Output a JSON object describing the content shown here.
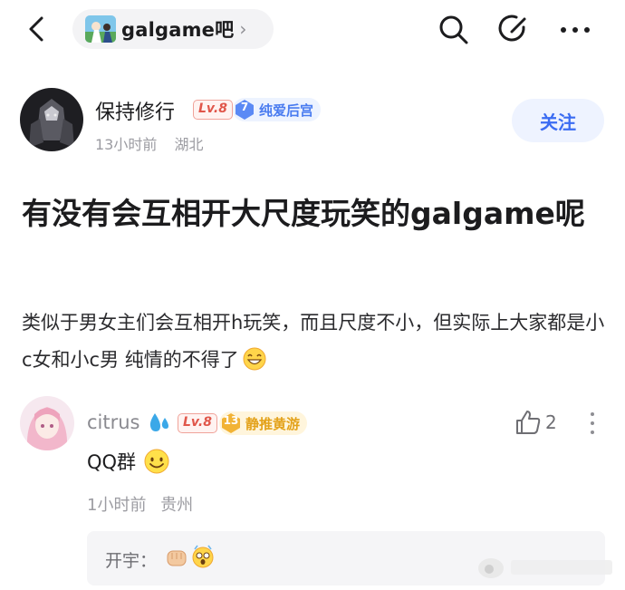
{
  "nav": {
    "forum_name": "galgame吧",
    "back_icon": "chevron-left-icon",
    "search_icon": "search-icon",
    "edit_icon": "edit-icon",
    "more_icon": "more-icon"
  },
  "author": {
    "name": "保持修行",
    "level": "Lv.8",
    "fan_level": "7",
    "fan_title": "纯爱后宫",
    "time": "13小时前",
    "location": "湖北",
    "follow_label": "关注"
  },
  "post": {
    "title": "有没有会互相开大尺度玩笑的galgame呢",
    "body": "类似于男女主们会互相开h玩笑，而且尺度不小，但实际上大家都是小c女和小c男 纯情的不得了"
  },
  "comment": {
    "name": "citrus",
    "level": "Lv.8",
    "fan_level": "13",
    "fan_title": "静推黄游",
    "likes": "2",
    "text": "QQ群",
    "time": "1小时前",
    "location": "贵州",
    "reply": {
      "author": "开宇："
    }
  },
  "colors": {
    "accent_blue": "#3b6cf2",
    "level_red": "#e0564a",
    "fan_blue": "#4a7cf0",
    "fan_gold": "#e3a21a"
  }
}
